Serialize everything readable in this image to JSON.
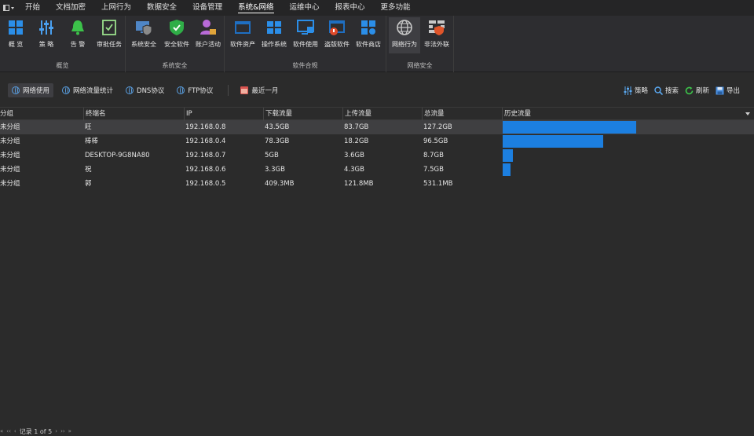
{
  "menubar": {
    "items": [
      "开始",
      "文档加密",
      "上网行为",
      "数据安全",
      "设备管理",
      "系统&网络",
      "运维中心",
      "报表中心",
      "更多功能"
    ],
    "active": "系统&网络"
  },
  "ribbon": {
    "groups": [
      {
        "label": "概览",
        "buttons": [
          {
            "label": "概 览",
            "icon": "grid-icon"
          },
          {
            "label": "策 略",
            "icon": "sliders-icon"
          },
          {
            "label": "告 警",
            "icon": "bell-icon"
          },
          {
            "label": "审批任务",
            "icon": "checklist-icon"
          }
        ]
      },
      {
        "label": "系统安全",
        "buttons": [
          {
            "label": "系统安全",
            "icon": "shield-monitor-icon"
          },
          {
            "label": "安全软件",
            "icon": "shield-check-icon"
          },
          {
            "label": "账户活动",
            "icon": "user-lock-icon"
          }
        ]
      },
      {
        "label": "软件合规",
        "buttons": [
          {
            "label": "软件资产",
            "icon": "window-icon"
          },
          {
            "label": "操作系统",
            "icon": "windows-icon"
          },
          {
            "label": "软件使用",
            "icon": "monitor-icon"
          },
          {
            "label": "盗版软件",
            "icon": "pirate-icon"
          },
          {
            "label": "软件商店",
            "icon": "store-icon"
          }
        ]
      },
      {
        "label": "网络安全",
        "buttons": [
          {
            "label": "网络行为",
            "icon": "globe-icon"
          },
          {
            "label": "非法外联",
            "icon": "firewall-icon"
          }
        ]
      }
    ]
  },
  "toolbar": {
    "tabs": [
      "网络使用",
      "网络流量统计",
      "DNS协议",
      "FTP协议"
    ],
    "range": "最近一月",
    "actions": [
      "策略",
      "搜索",
      "刷新",
      "导出"
    ]
  },
  "table": {
    "columns": [
      "分组",
      "终端名",
      "IP",
      "下载流量",
      "上传流量",
      "总流量",
      "历史流量"
    ],
    "rows": [
      {
        "group": "未分组",
        "name": "旺",
        "ip": "192.168.0.8",
        "down": "43.5GB",
        "up": "83.7GB",
        "total": "127.2GB",
        "history": 0.53
      },
      {
        "group": "未分组",
        "name": "棒棒",
        "ip": "192.168.0.4",
        "down": "78.3GB",
        "up": "18.2GB",
        "total": "96.5GB",
        "history": 0.4
      },
      {
        "group": "未分组",
        "name": "DESKTOP-9G8NA80",
        "ip": "192.168.0.7",
        "down": "5GB",
        "up": "3.6GB",
        "total": "8.7GB",
        "history": 0.04
      },
      {
        "group": "未分组",
        "name": "祝",
        "ip": "192.168.0.6",
        "down": "3.3GB",
        "up": "4.3GB",
        "total": "7.5GB",
        "history": 0.03
      },
      {
        "group": "未分组",
        "name": "郭",
        "ip": "192.168.0.5",
        "down": "409.3MB",
        "up": "121.8MB",
        "total": "531.1MB",
        "history": 0.0
      }
    ]
  },
  "footer": {
    "nav_first": "«",
    "nav_prev_page": "‹‹",
    "nav_prev": "‹",
    "records": "记录 1 of 5",
    "nav_next": "›",
    "nav_next_page": "››",
    "nav_last": "»"
  },
  "colors": {
    "accent": "#1c7fe0",
    "background": "#2b2b2b"
  }
}
